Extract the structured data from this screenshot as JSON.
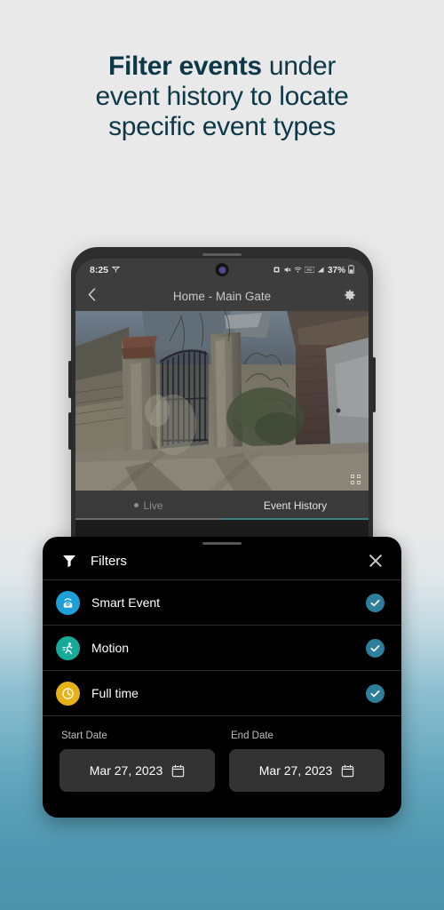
{
  "promo": {
    "headline_lines": [
      {
        "bold": "Filter events",
        "rest": " under"
      },
      {
        "bold": "",
        "rest": "event history to locate"
      },
      {
        "bold": "",
        "rest": "specific event types"
      }
    ],
    "headline_full": "Filter events under event history to locate specific event types",
    "text_color": "#0d3847",
    "background_top": "#e9e9e9",
    "background_bottom": "#4a93ab"
  },
  "phone": {
    "status_bar": {
      "time": "8:25",
      "location_icon": "location-arrow-icon",
      "icons": [
        "alarm-icon",
        "mute-icon",
        "wifi-icon",
        "hd-icon",
        "signal-icon"
      ],
      "battery_percent": "37%",
      "battery_icon": "battery-icon"
    },
    "app_bar": {
      "back_icon": "back-chevron-icon",
      "title": "Home - Main Gate",
      "settings_icon": "gear-icon"
    },
    "camera_feed": {
      "description": "Outdoor security camera view of iron gate between brick pillars",
      "fullscreen_icon": "fullscreen-icon"
    },
    "tabs": [
      {
        "label": "Live",
        "active": false,
        "has_dot": true
      },
      {
        "label": "Event History",
        "active": true,
        "has_dot": false
      }
    ]
  },
  "filters_sheet": {
    "drag_handle": "drag-handle",
    "funnel_icon": "filter-funnel-icon",
    "title": "Filters",
    "close_icon": "close-icon",
    "rows": [
      {
        "label": "Smart Event",
        "icon": "smart-event-camera-icon",
        "icon_color": "#1e9fd8",
        "checked": true
      },
      {
        "label": "Motion",
        "icon": "motion-running-icon",
        "icon_color": "#17a99a",
        "checked": true
      },
      {
        "label": "Full time",
        "icon": "full-time-clock-icon",
        "icon_color": "#e6b017",
        "checked": true
      }
    ],
    "check_color": "#2e7f9b",
    "start_date": {
      "label": "Start Date",
      "value": "Mar 27, 2023",
      "calendar_icon": "calendar-icon"
    },
    "end_date": {
      "label": "End Date",
      "value": "Mar 27, 2023",
      "calendar_icon": "calendar-icon"
    }
  }
}
